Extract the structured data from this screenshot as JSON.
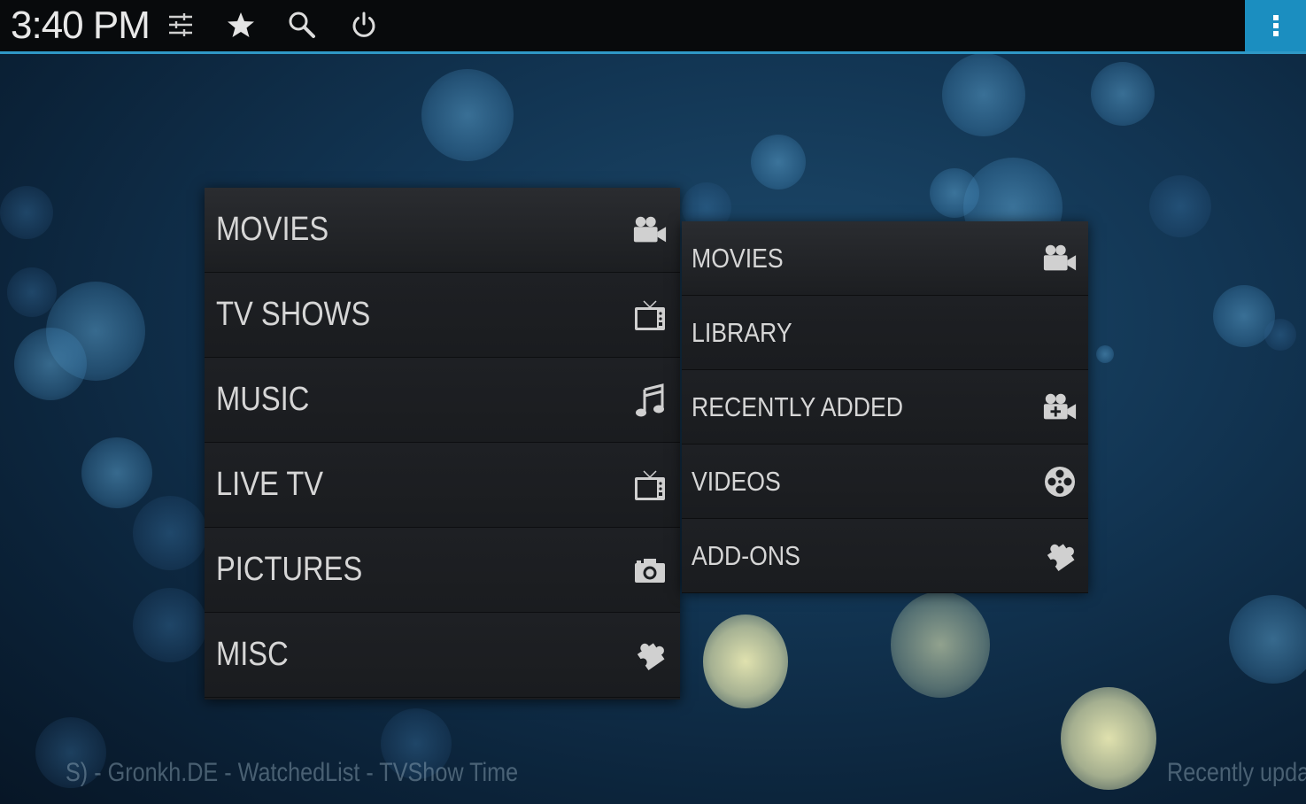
{
  "topbar": {
    "clock": "3:40 PM",
    "icons": [
      "settings-sliders-icon",
      "favourites-star-icon",
      "search-icon",
      "power-icon"
    ],
    "menu_icon": "overflow-menu-icon",
    "accent_color": "#2f98c6",
    "menu_color": "#1b8ec0"
  },
  "main_menu": {
    "items": [
      {
        "label": "MOVIES",
        "icon": "movie-camera-icon"
      },
      {
        "label": "TV SHOWS",
        "icon": "tv-icon"
      },
      {
        "label": "MUSIC",
        "icon": "music-note-icon"
      },
      {
        "label": "LIVE TV",
        "icon": "tv-icon"
      },
      {
        "label": "PICTURES",
        "icon": "camera-icon"
      },
      {
        "label": "MISC",
        "icon": "puzzle-icon"
      }
    ]
  },
  "submenu": {
    "items": [
      {
        "label": "MOVIES",
        "icon": "movie-camera-icon"
      },
      {
        "label": "LIBRARY",
        "icon": ""
      },
      {
        "label": "RECENTLY ADDED",
        "icon": "movie-camera-plus-icon"
      },
      {
        "label": "VIDEOS",
        "icon": "film-reel-icon"
      },
      {
        "label": "ADD-ONS",
        "icon": "puzzle-icon"
      }
    ]
  },
  "ticker": {
    "left_text": "S) - Gronkh.DE - WatchedList - TVShow Time",
    "right_text": "Recently upda"
  }
}
